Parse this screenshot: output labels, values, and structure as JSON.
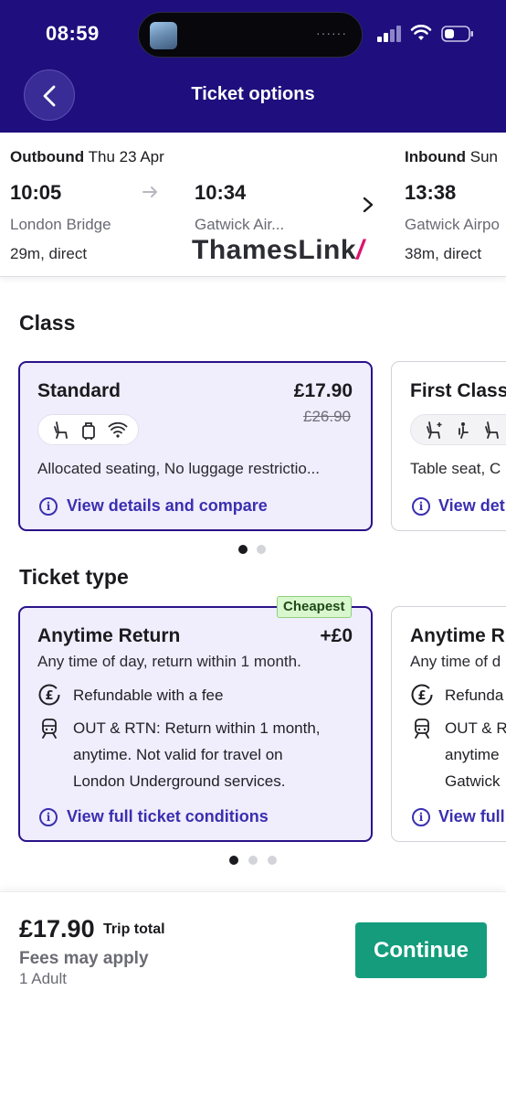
{
  "status_bar": {
    "time": "08:59"
  },
  "header": {
    "title": "Ticket options"
  },
  "journey": {
    "outbound": {
      "label": "Outbound",
      "date": "Thu 23 Apr",
      "depart_time": "10:05",
      "arrive_time": "10:34",
      "from": "London Bridge",
      "to": "Gatwick Air...",
      "summary": "29m, direct"
    },
    "inbound": {
      "label": "Inbound",
      "date": "Sun",
      "depart_time": "13:38",
      "from": "Gatwick Airpo",
      "summary": "38m, direct"
    },
    "operator_logo": {
      "text": "ThamesLink",
      "mark": "/"
    }
  },
  "class_section": {
    "title": "Class",
    "cards": [
      {
        "title": "Standard",
        "price": "£17.90",
        "old_price": "£26.90",
        "description": "Allocated seating, No luggage restrictio...",
        "link": "View details and compare",
        "selected": true
      },
      {
        "title": "First Class",
        "description": "Table seat, C",
        "link": "View det",
        "selected": false
      }
    ]
  },
  "ticket_section": {
    "title": "Ticket type",
    "badge": "Cheapest",
    "cards": [
      {
        "title": "Anytime Return",
        "price": "+£0",
        "subtitle": "Any time of day, return within 1 month.",
        "refund": "Refundable with a fee",
        "conditions": [
          "OUT & RTN: Return within 1 month,",
          "anytime. Not valid for travel on",
          "London Underground services."
        ],
        "link": "View full ticket conditions",
        "selected": true
      },
      {
        "title": "Anytime R",
        "subtitle": "Any time of d",
        "refund": "Refunda",
        "conditions": [
          "OUT & R",
          "anytime",
          "Gatwick"
        ],
        "link": "View full",
        "selected": false
      }
    ]
  },
  "footer": {
    "total_price": "£17.90",
    "total_label": "Trip total",
    "fees_note": "Fees may apply",
    "passengers": "1 Adult",
    "continue_label": "Continue"
  },
  "colors": {
    "brand_purple": "#1e0e7e",
    "accent_link": "#3a2fb0",
    "continue_green": "#149c7c",
    "thameslink_pink": "#e0116e"
  }
}
